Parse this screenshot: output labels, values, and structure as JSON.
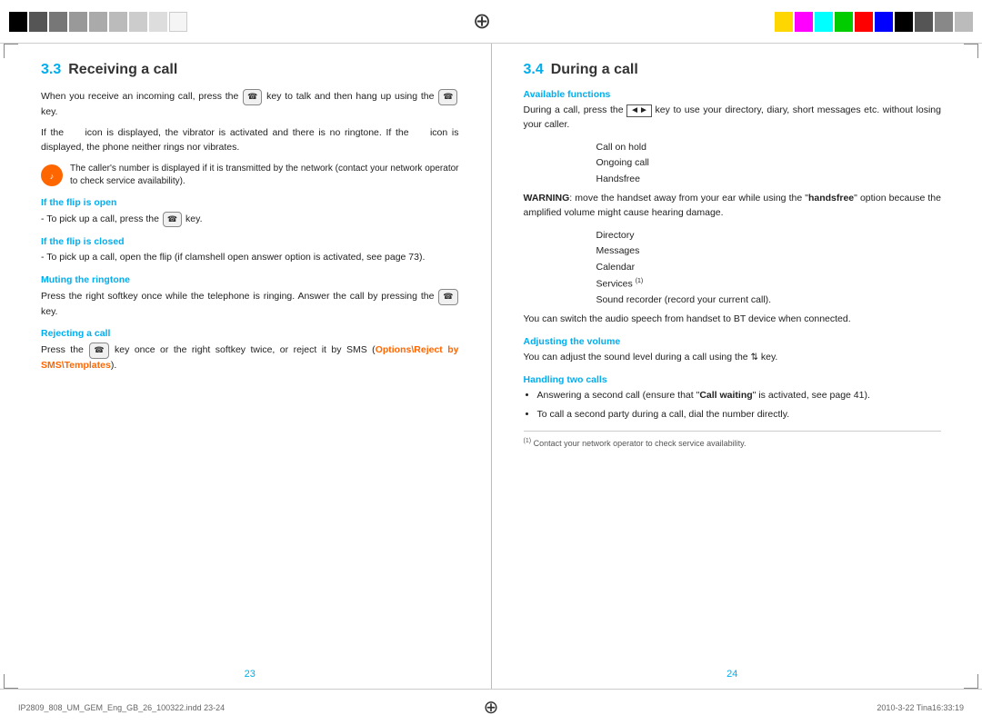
{
  "topbar": {
    "colors_left": [
      "#000",
      "#555",
      "#777",
      "#999",
      "#aaa",
      "#bbb",
      "#ccc",
      "#ddd",
      "#eee"
    ],
    "colors_right": [
      "#FFD700",
      "#FF00FF",
      "#00FFFF",
      "#00CC00",
      "#FF0000",
      "#0000FF",
      "#000",
      "#555",
      "#888",
      "#bbb"
    ]
  },
  "bottom": {
    "left_text": "IP2809_808_UM_GEM_Eng_GB_26_100322.indd  23-24",
    "right_text": "2010-3-22  Tina16:33:19"
  },
  "left_page": {
    "section_number": "3.3",
    "section_title": "Receiving a call",
    "intro": "When you receive an incoming call, press the  key to talk and then hang up using the  key.",
    "icon_text1": "If the icon is displayed, the vibrator is activated and there is no ringtone. If the icon is displayed, the phone neither rings nor vibrates.",
    "note": "The caller's number is displayed if it is transmitted by the network (contact your network operator to check service availability).",
    "flip_open_title": "If the flip is open",
    "flip_open_text": "- To pick up a call, press the  key.",
    "flip_closed_title": "If the flip is closed",
    "flip_closed_text": "- To pick up a call, open the flip (if clamshell open answer option is activated, see page 73).",
    "muting_title": "Muting the ringtone",
    "muting_text": "Press the right softkey once while the telephone is ringing. Answer the call by pressing the  key.",
    "rejecting_title": "Rejecting a call",
    "rejecting_text1": "Press the  key once or the right softkey twice, or reject it by SMS",
    "rejecting_link": "(Options\\Reject by SMS\\Templates)",
    "rejecting_text2": ".",
    "page_number": "23"
  },
  "right_page": {
    "section_number": "3.4",
    "section_title": "During a call",
    "available_functions_title": "Available functions",
    "available_intro": "During a call, press the ◄► key to use your directory, diary, short messages etc. without losing your caller.",
    "functions": [
      "Call on hold",
      "Ongoing call",
      "Handsfree"
    ],
    "warning_prefix": "WARNING",
    "warning_text": ": move the handset away from your ear while using the \"handsfree\" option because the amplified volume might cause hearing damage.",
    "functions2": [
      "Directory",
      "Messages",
      "Calendar",
      "Services (1)",
      "Sound recorder (record your current call)."
    ],
    "switch_text": "You can switch the audio speech from handset to BT device when connected.",
    "adjusting_title": "Adjusting the volume",
    "adjusting_text": "You can adjust the sound level during a call using the ▲▼ key.",
    "handling_title": "Handling two calls",
    "bullet1": "Answering a second call (ensure that \"Call waiting\" is activated, see page 41).",
    "bullet2": "To call a second party during a call, dial the number directly.",
    "footnote_superscript": "(1)",
    "footnote_text": "Contact your network operator to check service availability.",
    "page_number": "24"
  }
}
